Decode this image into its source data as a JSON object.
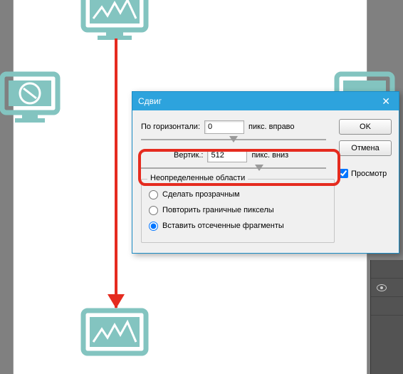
{
  "dialog": {
    "title": "Сдвиг",
    "horizontal": {
      "label": "По горизонтали:",
      "value": "0",
      "unit": "пикс. вправо"
    },
    "vertical": {
      "label": "Вертик.:",
      "value": "512",
      "unit": "пикс. вниз"
    },
    "undefined_areas": {
      "legend": "Неопределенные области",
      "opt_transparent": "Сделать прозрачным",
      "opt_repeat": "Повторить граничные пикселы",
      "opt_wrap": "Вставить отсеченные фрагменты"
    },
    "buttons": {
      "ok": "OK",
      "cancel": "Отмена"
    },
    "preview": {
      "label": "Просмотр"
    }
  }
}
